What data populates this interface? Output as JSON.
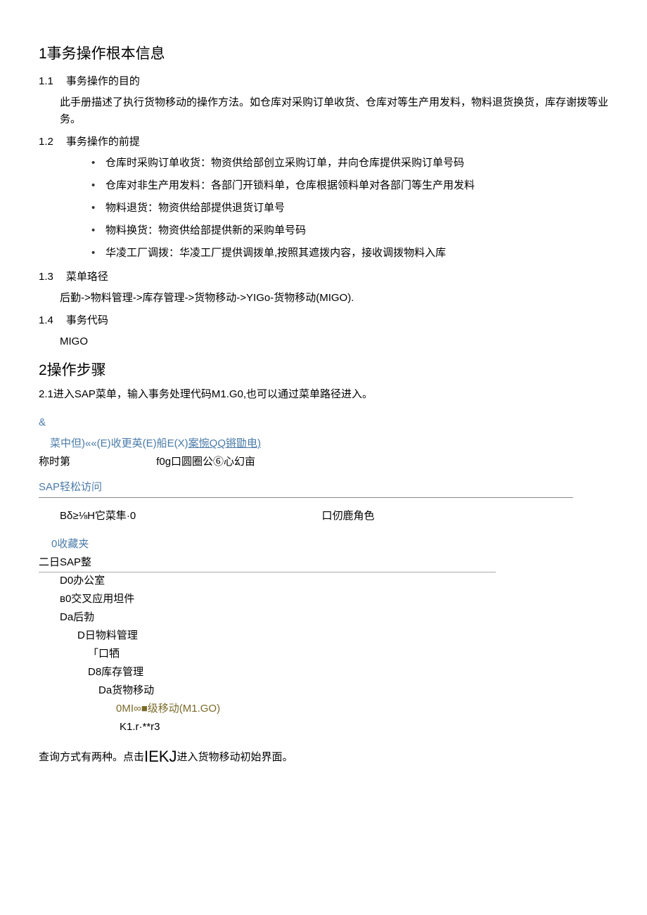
{
  "section1": {
    "title": "1事务操作根本信息",
    "s11": {
      "num": "1.1",
      "title": "事务操作的目的",
      "body": "此手册描述了执行货物移动的操作方法。如仓库对采购订单收货、仓库对等生产用发料，物料退货换货，库存谢拨等业务。"
    },
    "s12": {
      "num": "1.2",
      "title": "事务操作的前提",
      "bullets": {
        "b1": "仓库时采购订单收货：物资供给部创立采购订单，井向仓库提供采购订单号码",
        "b2": "仓库对非生产用发料：各部门开锁料单，仓库根据领料单对各部门等生产用发料",
        "b3": "物料退货：物资供给部提供退货订单号",
        "b4": "物料换货：物资供给部提供新的采购单号码",
        "b5": "华凌工厂调拨：华凌工厂提供调拨单,按照其遮拨内容，接收调拨物料入库"
      }
    },
    "s13": {
      "num": "1.3",
      "title": "菜单珞径",
      "body": "后勤->物料管理->库存管理->货物移动->YIGo-货物移动(MIGO)."
    },
    "s14": {
      "num": "1.4",
      "title": "事务代码",
      "body": "MIGO"
    }
  },
  "section2": {
    "title": "2操作步骤",
    "step": "2.1进入SAP菜单，输入事务处理代码M1.G0,也可以通过菜单路径进入。"
  },
  "sap": {
    "amp": "&",
    "menubar_plain": "菜中但)««(E)收更英(E)船E(X)",
    "menubar_underlined": "案惋QQ锵勖电)",
    "toolbar_left": "称时第",
    "toolbar_right": "f0g口圆圈公⑥心幻亩",
    "title": "SAP轻松访问",
    "sub_left": "Bδ≥⅛H它菜隼·0",
    "sub_right": "口仞鹿角色",
    "tree": {
      "fav": "0收藏夹",
      "root": "二日SAP整",
      "office": "D0办公室",
      "cross": "в0交叉应用坦件",
      "logistics": "Da后勃",
      "mm": "D日物料管理",
      "purchase": "「口牺",
      "im": "D8库存管理",
      "gm": "Da货物移动",
      "migo": "0MI∞■级移动(M1.GO)",
      "k1": "K1.r·**r3"
    }
  },
  "bottom": {
    "prefix": "查询方式有两种。点击",
    "big": "IEKJ",
    "suffix": "进入货物移动初始界面。"
  }
}
